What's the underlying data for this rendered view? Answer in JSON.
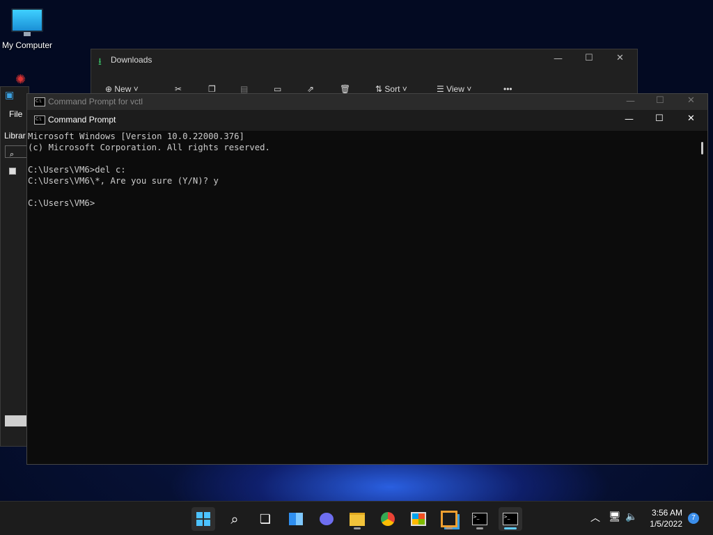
{
  "desktop": {
    "icons": [
      {
        "label": "My Computer",
        "icon": "computer-icon"
      }
    ]
  },
  "downloads_window": {
    "title": "Downloads",
    "toolbar": {
      "new_label": "New",
      "sort_label": "Sort",
      "view_label": "View"
    }
  },
  "vctl_window": {
    "menu_file": "File",
    "sidebar_label": "Librar"
  },
  "cmd_outer": {
    "title": "Command Prompt for vctl"
  },
  "cmd_inner": {
    "title": "Command Prompt",
    "console_lines": [
      "Microsoft Windows [Version 10.0.22000.376]",
      "(c) Microsoft Corporation. All rights reserved.",
      "",
      "C:\\Users\\VM6>del c:",
      "C:\\Users\\VM6\\*, Are you sure (Y/N)? y",
      "",
      "C:\\Users\\VM6>"
    ]
  },
  "taskbar": {
    "apps": [
      {
        "name": "start",
        "icon": "windows-logo-icon",
        "active": true
      },
      {
        "name": "search",
        "icon": "search-icon"
      },
      {
        "name": "task-view",
        "icon": "task-view-icon"
      },
      {
        "name": "widgets",
        "icon": "widgets-icon"
      },
      {
        "name": "chat",
        "icon": "chat-icon"
      },
      {
        "name": "file-explorer",
        "icon": "folder-icon",
        "running": true
      },
      {
        "name": "chrome",
        "icon": "chrome-icon"
      },
      {
        "name": "store",
        "icon": "store-icon"
      },
      {
        "name": "vmware",
        "icon": "vmware-icon",
        "running": true
      },
      {
        "name": "cmd-1",
        "icon": "terminal-icon",
        "running": true
      },
      {
        "name": "cmd-2",
        "icon": "terminal-icon",
        "running": true,
        "focused": true
      }
    ],
    "clock": {
      "time": "3:56 AM",
      "date": "1/5/2022"
    },
    "notification_count": "7"
  },
  "colors": {
    "accent": "#60cdff",
    "console_bg": "#0c0c0c",
    "console_text": "#cccccc"
  }
}
